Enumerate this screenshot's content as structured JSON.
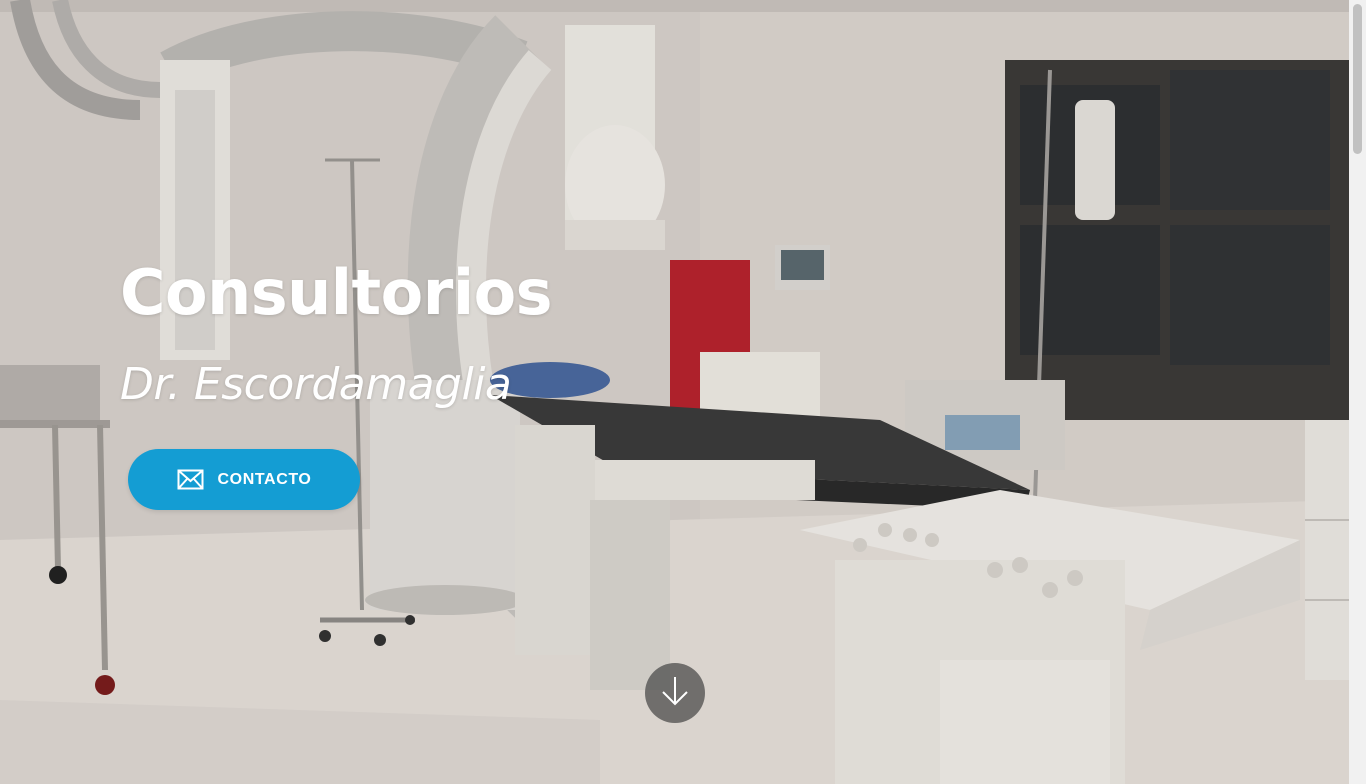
{
  "hero": {
    "title": "Consultorios",
    "subtitle": "Dr. Escordamaglia",
    "button_label": "CONTACTO",
    "button_icon": "envelope-icon",
    "scroll_icon": "arrow-down-icon",
    "background_image": "operating-room-photo"
  },
  "colors": {
    "accent": "#149dd3",
    "text": "#ffffff",
    "scroll_button": "#464646"
  }
}
